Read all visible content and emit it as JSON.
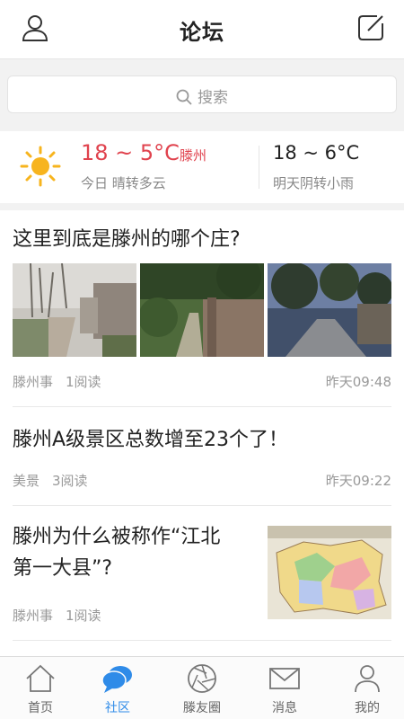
{
  "header": {
    "title": "论坛",
    "left_icon": "user-icon",
    "right_icon": "compose-icon"
  },
  "search": {
    "placeholder": "搜索"
  },
  "weather": {
    "today": {
      "temp": "18 ~ 5°C",
      "city": "滕州",
      "desc": "今日 晴转多云",
      "icon": "sun-icon"
    },
    "tomorrow": {
      "temp": "18 ~ 6°C",
      "desc": "明天阴转小雨"
    }
  },
  "posts": [
    {
      "title": "这里到底是滕州的哪个庄?",
      "category": "滕州事",
      "reads": "1阅读",
      "time": "昨天09:48",
      "images": [
        "village-road-photo",
        "tree-lane-photo",
        "dusk-road-photo"
      ]
    },
    {
      "title": "滕州A级景区总数增至23个了！",
      "category": "美景",
      "reads": "3阅读",
      "time": "昨天09:22"
    },
    {
      "title_line1": "滕州为什么被称作“江北",
      "title_line2": "第一大县”?",
      "category": "滕州事",
      "reads": "1阅读",
      "image": "county-map-photo"
    }
  ],
  "tabbar": [
    {
      "label": "首页",
      "icon": "home-icon",
      "active": false
    },
    {
      "label": "社区",
      "icon": "chat-bubble-icon",
      "active": true
    },
    {
      "label": "滕友圈",
      "icon": "aperture-icon",
      "active": false
    },
    {
      "label": "消息",
      "icon": "mail-icon",
      "active": false
    },
    {
      "label": "我的",
      "icon": "person-icon",
      "active": false
    }
  ],
  "colors": {
    "accent": "#2f8be8",
    "temp_red": "#e0434e"
  }
}
